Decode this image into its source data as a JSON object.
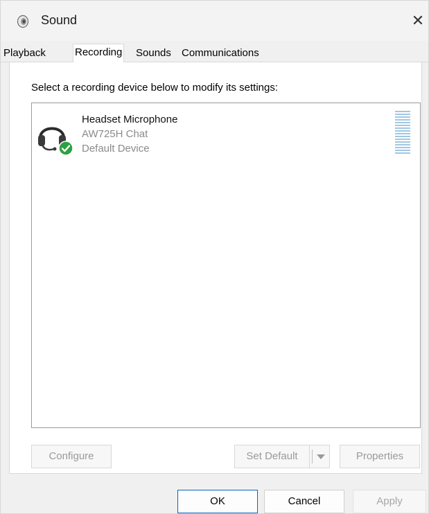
{
  "window": {
    "title": "Sound",
    "close_glyph": "✕",
    "icon": "speaker-icon"
  },
  "tabs": [
    {
      "label": "Playback"
    },
    {
      "label": "Recording"
    },
    {
      "label": "Sounds"
    },
    {
      "label": "Communications"
    }
  ],
  "active_tab": "Recording",
  "panel": {
    "instruction": "Select a recording device below to modify its settings:",
    "devices": [
      {
        "name": "Headset Microphone",
        "description": "AW725H Chat",
        "status": "Default Device",
        "icon": "headset-icon",
        "badge_icon": "check-badge-icon"
      }
    ],
    "buttons": {
      "configure": "Configure",
      "set_default": "Set Default",
      "properties": "Properties"
    }
  },
  "footer": {
    "ok": "OK",
    "cancel": "Cancel",
    "apply": "Apply"
  },
  "colors": {
    "accent": "#0067c0",
    "level_meter": "#9fc7e2",
    "default_badge": "#2ea043"
  }
}
